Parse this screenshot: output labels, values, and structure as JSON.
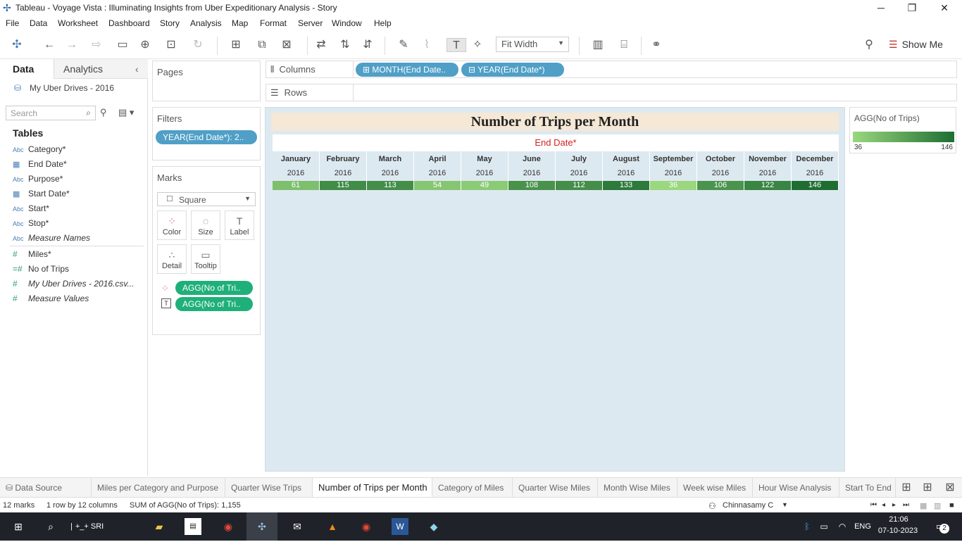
{
  "window": {
    "title": "Tableau - Voyage Vista : Illuminating Insights from Uber Expeditionary Analysis - Story"
  },
  "menu": [
    "File",
    "Data",
    "Worksheet",
    "Dashboard",
    "Story",
    "Analysis",
    "Map",
    "Format",
    "Server",
    "Window",
    "Help"
  ],
  "toolbar": {
    "fit_label": "Fit Width",
    "show_me": "Show Me"
  },
  "datapane": {
    "tab_data": "Data",
    "tab_analytics": "Analytics",
    "source": "My Uber Drives - 2016",
    "search_placeholder": "Search",
    "tables_label": "Tables",
    "dimensions": [
      {
        "type": "Abc",
        "name": "Category*"
      },
      {
        "type": "date",
        "name": "End Date*"
      },
      {
        "type": "Abc",
        "name": "Purpose*"
      },
      {
        "type": "date",
        "name": "Start Date*"
      },
      {
        "type": "Abc",
        "name": "Start*"
      },
      {
        "type": "Abc",
        "name": "Stop*"
      },
      {
        "type": "Abc",
        "name": "Measure Names"
      }
    ],
    "measures": [
      {
        "type": "#",
        "name": "Miles*"
      },
      {
        "type": "=#",
        "name": "No of Trips"
      },
      {
        "type": "#",
        "name": "My Uber Drives - 2016.csv..."
      },
      {
        "type": "#",
        "name": "Measure Values"
      }
    ]
  },
  "pages": {
    "label": "Pages"
  },
  "filters": {
    "label": "Filters",
    "pill": "YEAR(End Date*): 2.."
  },
  "marks": {
    "label": "Marks",
    "type": "Square",
    "buttons": [
      "Color",
      "Size",
      "Label",
      "Detail",
      "Tooltip"
    ],
    "pills": [
      "AGG(No of  Tri..",
      "AGG(No of  Tri.."
    ]
  },
  "shelves": {
    "columns_label": "Columns",
    "rows_label": "Rows",
    "column_pills": [
      "MONTH(End Date..",
      "YEAR(End Date*)"
    ]
  },
  "viz": {
    "title": "Number of Trips per Month",
    "header": "End Date*"
  },
  "chart_data": {
    "type": "table",
    "title": "Number of Trips per Month",
    "xlabel": "End Date*",
    "categories": [
      "January",
      "February",
      "March",
      "April",
      "May",
      "June",
      "July",
      "August",
      "September",
      "October",
      "November",
      "December"
    ],
    "years": [
      "2016",
      "2016",
      "2016",
      "2016",
      "2016",
      "2016",
      "2016",
      "2016",
      "2016",
      "2016",
      "2016",
      "2016"
    ],
    "values": [
      61,
      115,
      113,
      54,
      49,
      108,
      112,
      133,
      36,
      106,
      122,
      146
    ],
    "color_range": [
      36,
      146
    ],
    "color_low": "#9ad77e",
    "color_high": "#1e6e32"
  },
  "legend": {
    "title": "AGG(No of  Trips)",
    "min": "36",
    "max": "146"
  },
  "sheet_tabs": {
    "data_source": "Data Source",
    "items": [
      "Miles per Category and Purpose",
      "Quarter Wise Trips",
      "Number of Trips per Month",
      "Category of Miles",
      "Quarter Wise Miles",
      "Month Wise Miles",
      "Week wise Miles",
      "Hour Wise Analysis",
      "Start To End"
    ],
    "active_index": 2
  },
  "status": {
    "marks": "12 marks",
    "dims": "1 row by 12 columns",
    "sum": "SUM of AGG(No of  Trips): 1,155",
    "user": "Chinnasamy C"
  },
  "taskbar": {
    "search_text": "+_+ SRI",
    "lang": "ENG",
    "time": "21:06",
    "date": "07-10-2023",
    "notif": "2"
  }
}
